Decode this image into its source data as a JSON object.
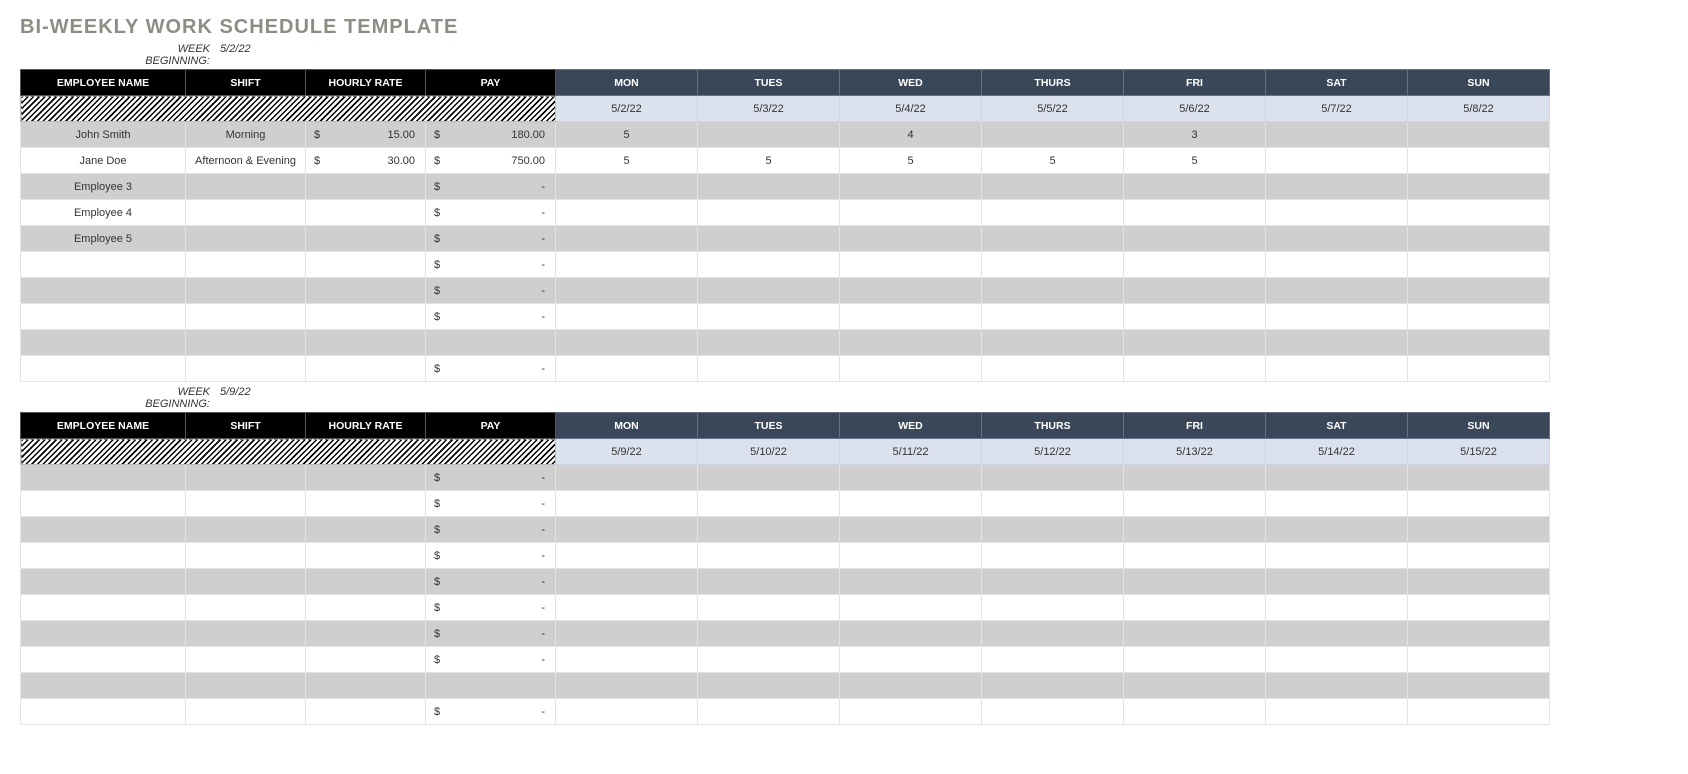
{
  "title": "BI-WEEKLY WORK SCHEDULE TEMPLATE",
  "week_beginning_label": "WEEK BEGINNING:",
  "headers": {
    "name": "EMPLOYEE NAME",
    "shift": "SHIFT",
    "rate": "HOURLY RATE",
    "pay": "PAY",
    "mon": "MON",
    "tue": "TUES",
    "wed": "WED",
    "thu": "THURS",
    "fri": "FRI",
    "sat": "SAT",
    "sun": "SUN"
  },
  "weeks": [
    {
      "begin_date": "5/2/22",
      "dates": [
        "5/2/22",
        "5/3/22",
        "5/4/22",
        "5/5/22",
        "5/6/22",
        "5/7/22",
        "5/8/22"
      ],
      "rows": [
        {
          "name": "John Smith",
          "shift": "Morning",
          "rate": "15.00",
          "pay": "180.00",
          "days": [
            "5",
            "",
            "4",
            "",
            "3",
            "",
            ""
          ],
          "zebra": "gray"
        },
        {
          "name": "Jane Doe",
          "shift": "Afternoon & Evening",
          "rate": "30.00",
          "pay": "750.00",
          "days": [
            "5",
            "5",
            "5",
            "5",
            "5",
            "",
            ""
          ],
          "zebra": "white"
        },
        {
          "name": "Employee 3",
          "shift": "",
          "rate": "",
          "pay": "-",
          "days": [
            "",
            "",
            "",
            "",
            "",
            "",
            ""
          ],
          "zebra": "gray"
        },
        {
          "name": "Employee 4",
          "shift": "",
          "rate": "",
          "pay": "-",
          "days": [
            "",
            "",
            "",
            "",
            "",
            "",
            ""
          ],
          "zebra": "white"
        },
        {
          "name": "Employee 5",
          "shift": "",
          "rate": "",
          "pay": "-",
          "days": [
            "",
            "",
            "",
            "",
            "",
            "",
            ""
          ],
          "zebra": "gray"
        },
        {
          "name": "",
          "shift": "",
          "rate": "",
          "pay": "-",
          "days": [
            "",
            "",
            "",
            "",
            "",
            "",
            ""
          ],
          "zebra": "white"
        },
        {
          "name": "",
          "shift": "",
          "rate": "",
          "pay": "-",
          "days": [
            "",
            "",
            "",
            "",
            "",
            "",
            ""
          ],
          "zebra": "gray"
        },
        {
          "name": "",
          "shift": "",
          "rate": "",
          "pay": "-",
          "days": [
            "",
            "",
            "",
            "",
            "",
            "",
            ""
          ],
          "zebra": "white"
        },
        {
          "name": "",
          "shift": "",
          "rate": "",
          "pay": "",
          "days": [
            "",
            "",
            "",
            "",
            "",
            "",
            ""
          ],
          "zebra": "gray",
          "no_dollar": true
        },
        {
          "name": "",
          "shift": "",
          "rate": "",
          "pay": "-",
          "days": [
            "",
            "",
            "",
            "",
            "",
            "",
            ""
          ],
          "zebra": "white"
        }
      ]
    },
    {
      "begin_date": "5/9/22",
      "dates": [
        "5/9/22",
        "5/10/22",
        "5/11/22",
        "5/12/22",
        "5/13/22",
        "5/14/22",
        "5/15/22"
      ],
      "rows": [
        {
          "name": "",
          "shift": "",
          "rate": "",
          "pay": "-",
          "days": [
            "",
            "",
            "",
            "",
            "",
            "",
            ""
          ],
          "zebra": "gray"
        },
        {
          "name": "",
          "shift": "",
          "rate": "",
          "pay": "-",
          "days": [
            "",
            "",
            "",
            "",
            "",
            "",
            ""
          ],
          "zebra": "white"
        },
        {
          "name": "",
          "shift": "",
          "rate": "",
          "pay": "-",
          "days": [
            "",
            "",
            "",
            "",
            "",
            "",
            ""
          ],
          "zebra": "gray"
        },
        {
          "name": "",
          "shift": "",
          "rate": "",
          "pay": "-",
          "days": [
            "",
            "",
            "",
            "",
            "",
            "",
            ""
          ],
          "zebra": "white"
        },
        {
          "name": "",
          "shift": "",
          "rate": "",
          "pay": "-",
          "days": [
            "",
            "",
            "",
            "",
            "",
            "",
            ""
          ],
          "zebra": "gray"
        },
        {
          "name": "",
          "shift": "",
          "rate": "",
          "pay": "-",
          "days": [
            "",
            "",
            "",
            "",
            "",
            "",
            ""
          ],
          "zebra": "white"
        },
        {
          "name": "",
          "shift": "",
          "rate": "",
          "pay": "-",
          "days": [
            "",
            "",
            "",
            "",
            "",
            "",
            ""
          ],
          "zebra": "gray"
        },
        {
          "name": "",
          "shift": "",
          "rate": "",
          "pay": "-",
          "days": [
            "",
            "",
            "",
            "",
            "",
            "",
            ""
          ],
          "zebra": "white"
        },
        {
          "name": "",
          "shift": "",
          "rate": "",
          "pay": "",
          "days": [
            "",
            "",
            "",
            "",
            "",
            "",
            ""
          ],
          "zebra": "gray",
          "no_dollar": true
        },
        {
          "name": "",
          "shift": "",
          "rate": "",
          "pay": "-",
          "days": [
            "",
            "",
            "",
            "",
            "",
            "",
            ""
          ],
          "zebra": "white"
        }
      ]
    }
  ]
}
